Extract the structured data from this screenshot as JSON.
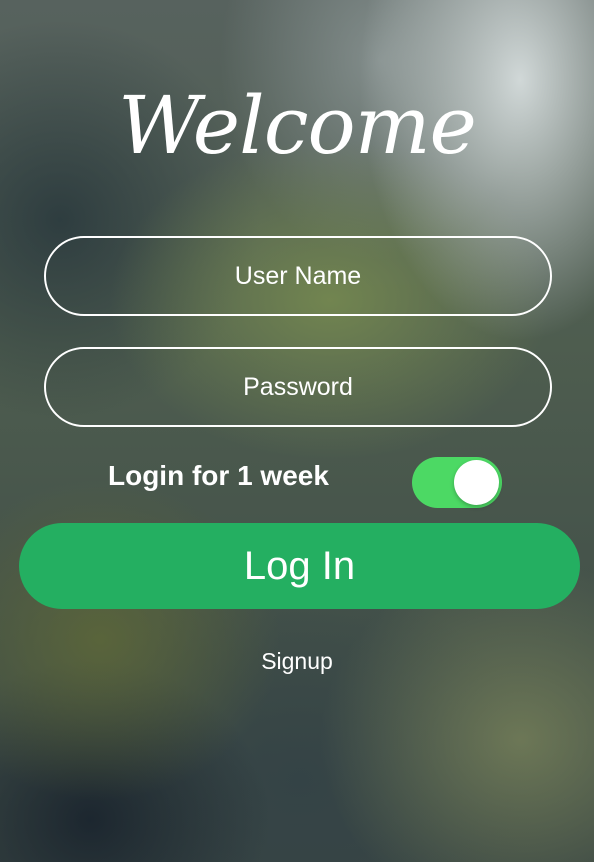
{
  "header": {
    "title": "Welcome"
  },
  "form": {
    "username_placeholder": "User Name",
    "username_value": "",
    "password_placeholder": "Password",
    "password_value": "",
    "remember_label": "Login for 1 week",
    "remember_enabled": true,
    "login_label": "Log In",
    "signup_label": "Signup"
  },
  "colors": {
    "toggle_on": "#4cd964",
    "login_button": "#24af61",
    "text": "#ffffff"
  }
}
